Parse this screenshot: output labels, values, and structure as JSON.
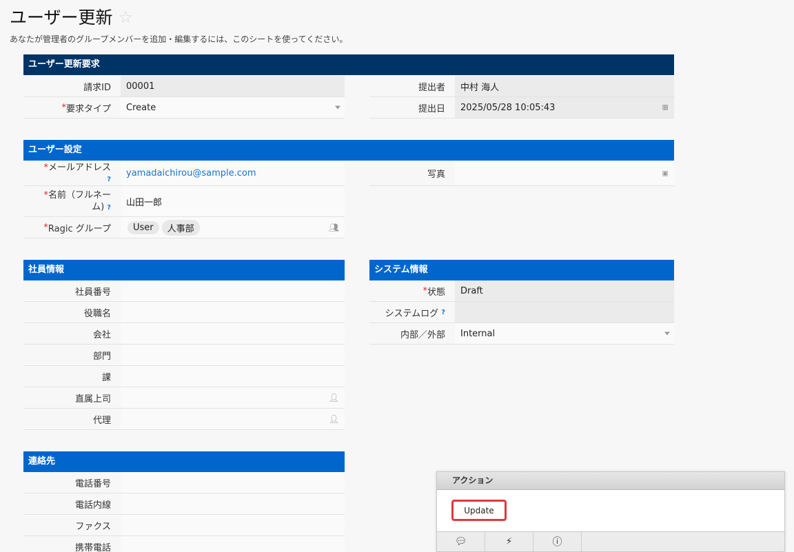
{
  "page": {
    "title": "ユーザー更新",
    "description": "あなたが管理者のグループメンバーを追加・編集するには、このシートを使ってください。"
  },
  "sections": {
    "request": "ユーザー更新要求",
    "user": "ユーザー設定",
    "employee": "社員情報",
    "system": "システム情報",
    "contact": "連絡先"
  },
  "request": {
    "id_label": "請求ID",
    "id_value": "00001",
    "type_label": "要求タイプ",
    "type_value": "Create",
    "submitter_label": "提出者",
    "submitter_value": "中村 海人",
    "date_label": "提出日",
    "date_value": "2025/05/28 10:05:43"
  },
  "user": {
    "email_label": "メールアドレス",
    "email_value": "yamadaichirou@sample.com",
    "photo_label": "写真",
    "name_label_1": "名前（フルネー",
    "name_label_2": "ム)",
    "name_value": "山田一郎",
    "group_label": "Ragic グループ",
    "groups": [
      "User",
      "人事部"
    ]
  },
  "employee": {
    "number": "社員番号",
    "position": "役職名",
    "company": "会社",
    "department": "部門",
    "section": "課",
    "supervisor": "直属上司",
    "proxy": "代理"
  },
  "system": {
    "status_label": "状態",
    "status_value": "Draft",
    "log_label": "システムログ",
    "scope_label": "内部／外部",
    "scope_value": "Internal"
  },
  "contact": {
    "phone": "電話番号",
    "ext": "電話内線",
    "fax": "ファクス",
    "mobile": "携帯電話"
  },
  "actions": {
    "header": "アクション",
    "update": "Update"
  },
  "common": {
    "required_mark": "*",
    "help_mark": "?"
  }
}
